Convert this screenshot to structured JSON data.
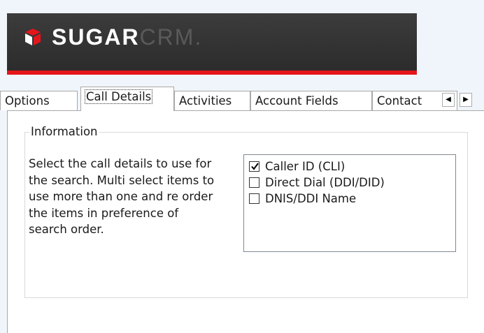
{
  "brand": {
    "logo_part1": "SUGAR",
    "logo_part2": "CRM.",
    "accent_color": "#e4161b",
    "banner_color": "#333333"
  },
  "tabs": [
    {
      "label": "Options",
      "active": false
    },
    {
      "label": "Call Details",
      "active": true
    },
    {
      "label": "Activities",
      "active": false
    },
    {
      "label": "Account Fields",
      "active": false
    },
    {
      "label": "Contact",
      "active": false
    }
  ],
  "tab_scroll": {
    "left_icon": "arrow-left-icon",
    "right_icon": "arrow-right-icon"
  },
  "group": {
    "title": "Information",
    "description": "Select the call details to use for the search. Multi select items to use more than one and re order the items in preference of search order."
  },
  "call_details_list": [
    {
      "label": "Caller ID (CLI)",
      "checked": true
    },
    {
      "label": "Direct Dial (DDI/DID)",
      "checked": false
    },
    {
      "label": "DNIS/DDI Name",
      "checked": false
    }
  ]
}
